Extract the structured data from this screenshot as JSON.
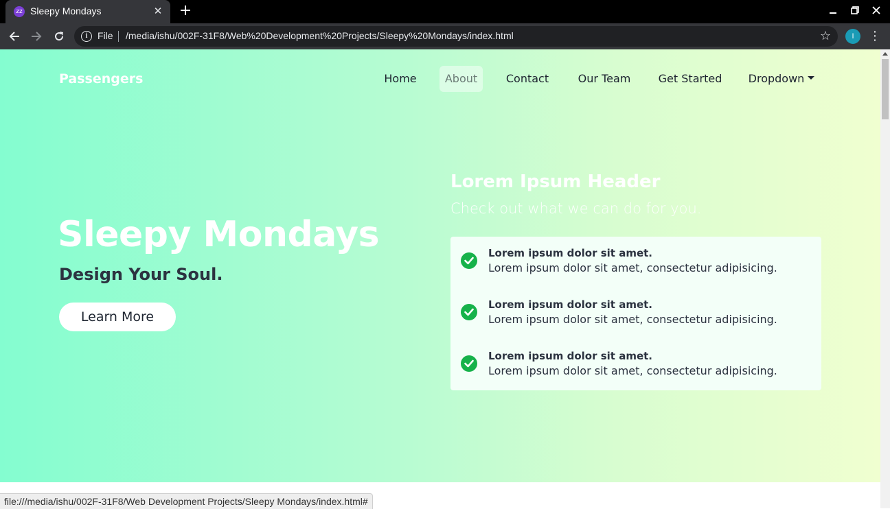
{
  "browser": {
    "tab_title": "Sleepy Mondays",
    "tab_favicon": "zz",
    "tab_close": "✕",
    "new_tab": "+",
    "omnibox_prefix": "File",
    "url": "/media/ishu/002F-31F8/Web%20Development%20Projects/Sleepy%20Mondays/index.html",
    "profile_initial": "I",
    "status_url": "file:///media/ishu/002F-31F8/Web Development Projects/Sleepy Mondays/index.html#"
  },
  "navbar": {
    "brand": "Passengers",
    "links": [
      "Home",
      "About",
      "Contact",
      "Our Team",
      "Get Started",
      "Dropdown"
    ],
    "active": "About"
  },
  "hero": {
    "title": "Sleepy Mondays",
    "subtitle": "Design Your Soul.",
    "button": "Learn More"
  },
  "info": {
    "header": "Lorem Ipsum Header",
    "subheader": "Check out what we can do for you.",
    "features": [
      {
        "title": "Lorem ipsum dolor sit amet.",
        "text": "Lorem ipsum dolor sit amet, consectetur adipisicing."
      },
      {
        "title": "Lorem ipsum dolor sit amet.",
        "text": "Lorem ipsum dolor sit amet, consectetur adipisicing."
      },
      {
        "title": "Lorem ipsum dolor sit amet.",
        "text": "Lorem ipsum dolor sit amet, consectetur adipisicing."
      }
    ]
  },
  "colors": {
    "gradient_start": "#84fdd0",
    "gradient_end": "#f0ffd0",
    "check_green": "#16b24a"
  },
  "icons": [
    "back-icon",
    "forward-icon",
    "reload-icon",
    "info-icon",
    "star-icon",
    "kebab-menu-icon",
    "check-circle-icon",
    "caret-down-icon"
  ]
}
